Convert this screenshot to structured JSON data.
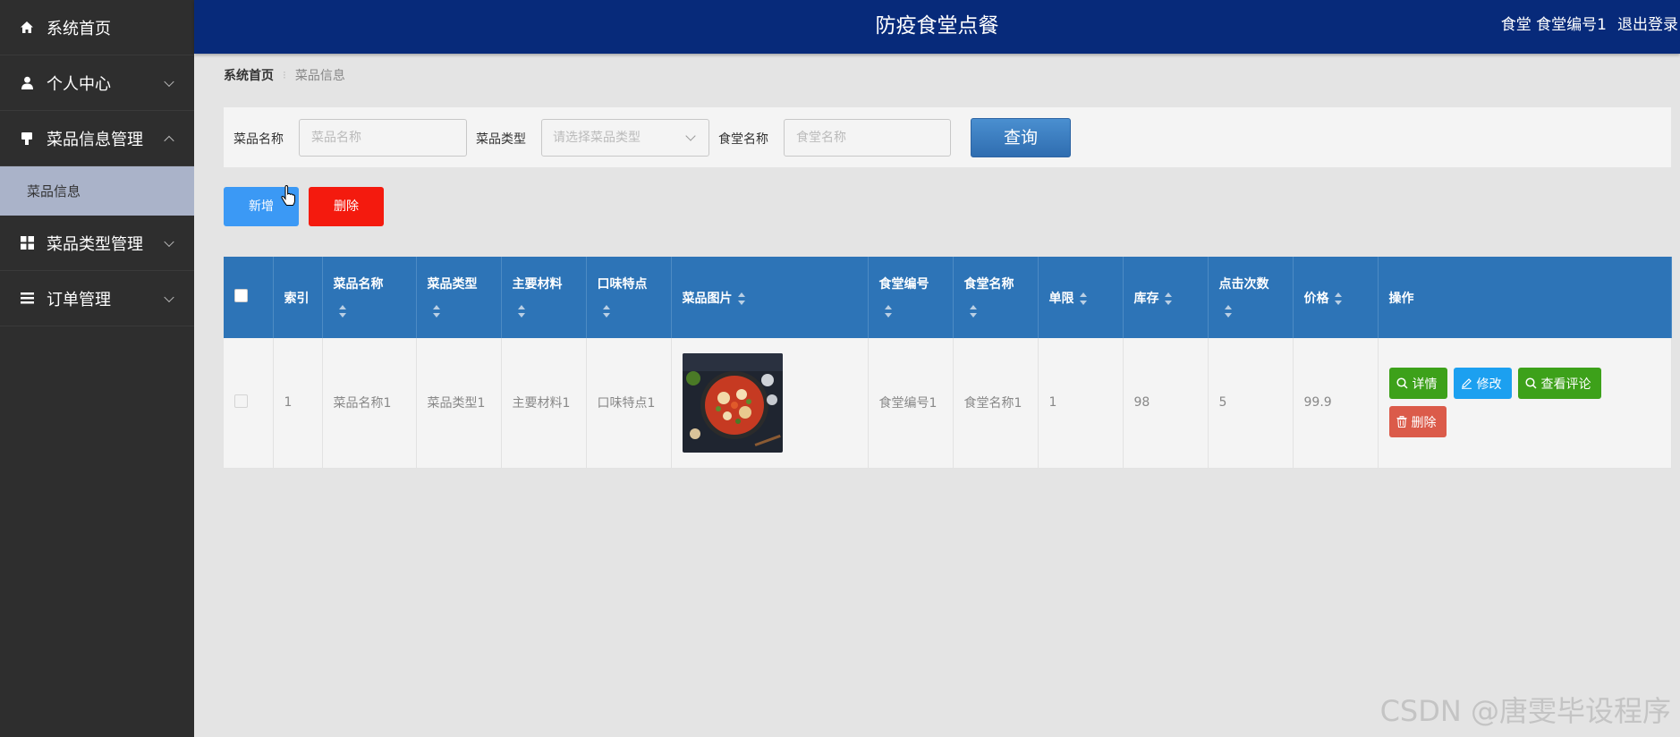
{
  "header": {
    "title": "防疫食堂点餐",
    "user": "食堂 食堂编号1",
    "logout": "退出登录"
  },
  "sidebar": {
    "items": [
      {
        "label": "系统首页",
        "icon": "home-icon"
      },
      {
        "label": "个人中心",
        "icon": "user-icon"
      },
      {
        "label": "菜品信息管理",
        "icon": "dish-icon",
        "sub": "菜品信息"
      },
      {
        "label": "菜品类型管理",
        "icon": "grid-icon"
      },
      {
        "label": "订单管理",
        "icon": "list-icon"
      }
    ]
  },
  "breadcrumb": {
    "home": "系统首页",
    "current": "菜品信息"
  },
  "search": {
    "dish_label": "菜品名称",
    "dish_placeholder": "菜品名称",
    "type_label": "菜品类型",
    "type_placeholder": "请选择菜品类型",
    "canteen_label": "食堂名称",
    "canteen_placeholder": "食堂名称",
    "query_label": "查询"
  },
  "actions": {
    "add_label": "新增",
    "delete_label": "删除"
  },
  "table": {
    "headers": [
      "索引",
      "菜品名称",
      "菜品类型",
      "主要材料",
      "口味特点",
      "菜品图片",
      "食堂编号",
      "食堂名称",
      "单限",
      "库存",
      "点击次数",
      "价格",
      "操作"
    ],
    "rows": [
      {
        "index": "1",
        "name": "菜品名称1",
        "type": "菜品类型1",
        "material": "主要材料1",
        "flavor": "口味特点1",
        "canteen_no": "食堂编号1",
        "canteen_name": "食堂名称1",
        "limit": "1",
        "stock": "98",
        "clicks": "5",
        "price": "99.9"
      }
    ],
    "ops": {
      "detail": "详情",
      "edit": "修改",
      "comments": "查看评论",
      "delete": "删除"
    }
  },
  "colors": {
    "header": "#072a7a",
    "sidebar": "#2e2e2e",
    "table_header": "#2d74b7",
    "add": "#3b99f5",
    "delete": "#f41a0e",
    "green": "#3da11a",
    "blue": "#1ca0f0",
    "red": "#db5b4a"
  },
  "watermark": "CSDN @唐雯毕设程序"
}
